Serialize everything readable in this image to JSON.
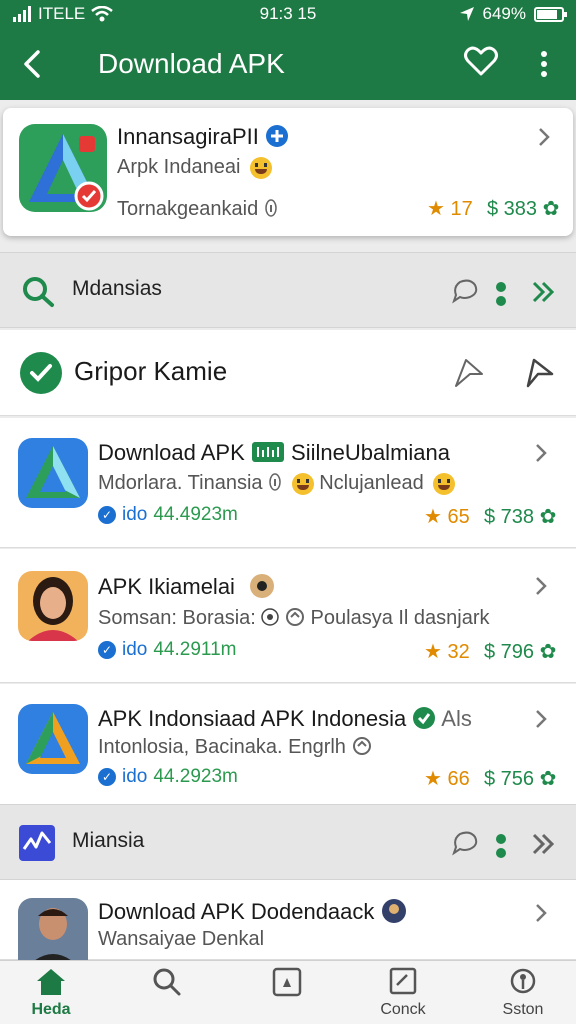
{
  "status_bar": {
    "carrier": "ITELE",
    "time": "91:3 15",
    "battery": "649%"
  },
  "app_bar": {
    "title": "Download APK"
  },
  "featured": {
    "title": "InnansagiraPII",
    "subtitle": "Arpk Indaneai",
    "meta": "Tornakgeankaid",
    "rating": "17",
    "price": "$ 383"
  },
  "sections": [
    {
      "label": "Mdansias"
    },
    {
      "label": "Miansia"
    }
  ],
  "highlight": {
    "label": "Gripor Kamie"
  },
  "items": [
    {
      "title": "Download APK",
      "title_extra": "SiilneUbalmiana",
      "subtitle": "Mdorlara. Tinansia",
      "subtitle_extra": "Nclujanlead",
      "meta_prefix": "ido",
      "meta_value": "44.4923m",
      "rating": "65",
      "price": "$ 738"
    },
    {
      "title": "APK Ikiamelai",
      "subtitle": "Somsan: Borasia:",
      "subtitle_extra": "Poulasya Il dasnjark",
      "meta_prefix": "ido",
      "meta_value": "44.2911m",
      "rating": "32",
      "price": "$ 796"
    },
    {
      "title": "APK Indonsiaad APK Indonesia",
      "title_extra": "Als",
      "subtitle": "Intonlosia, Bacinaka. Engrlh",
      "meta_prefix": "ido",
      "meta_value": "44.2923m",
      "rating": "66",
      "price": "$ 756"
    },
    {
      "title": "Download APK Dodendaack",
      "subtitle": "Wansaiyae Denkal"
    }
  ],
  "bottom_nav": [
    {
      "label": "Heda",
      "icon": "home-icon"
    },
    {
      "label": "",
      "icon": "search-icon"
    },
    {
      "label": "",
      "icon": "apps-icon"
    },
    {
      "label": "Conck",
      "icon": "edit-icon"
    },
    {
      "label": "Sston",
      "icon": "location-icon"
    }
  ],
  "colors": {
    "primary": "#1e7a44",
    "rating": "#e08a00",
    "price": "#1f8a4c",
    "meta_blue": "#1a6fd1"
  }
}
